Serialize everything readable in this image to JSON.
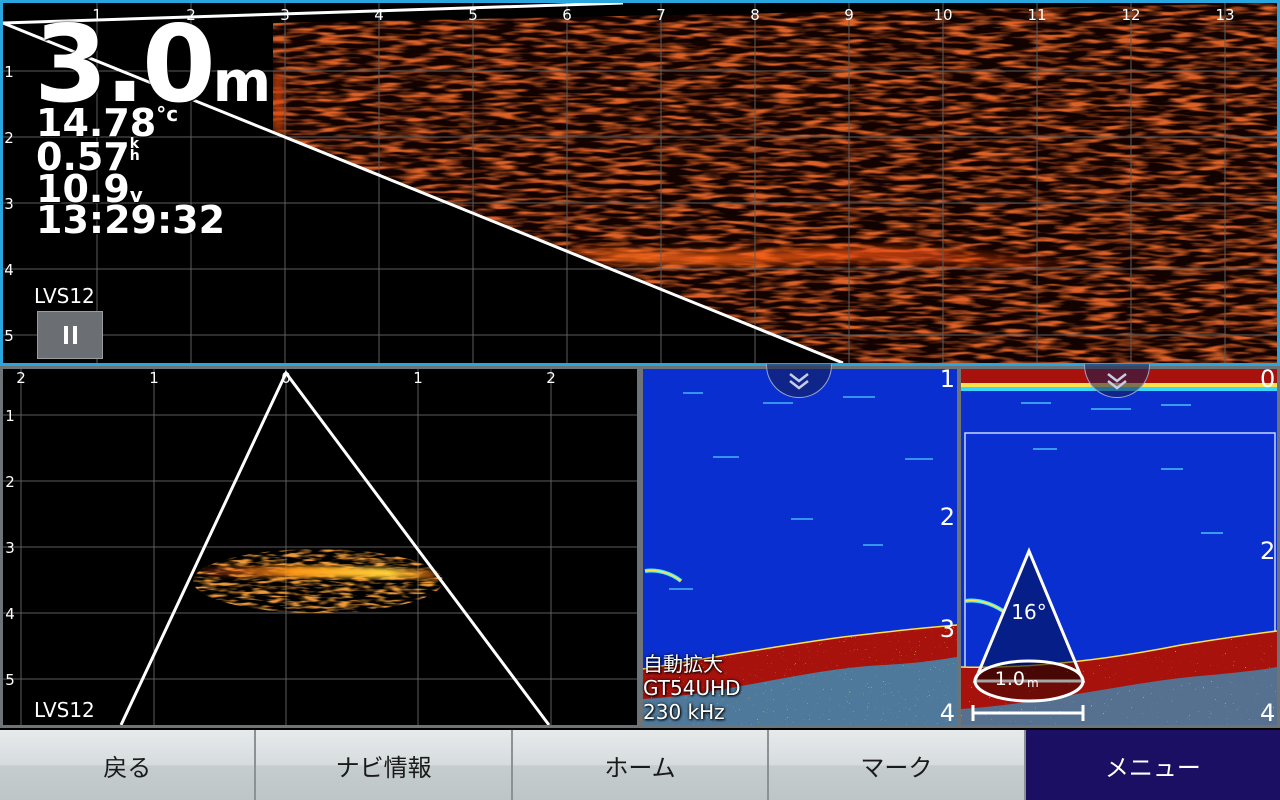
{
  "top_panel": {
    "depth_value": "3.0",
    "depth_unit": "m",
    "water_temp": "14.78",
    "water_temp_unit": "°c",
    "speed": "0.57",
    "speed_unit": "kh",
    "voltage": "10.9",
    "voltage_unit": "v",
    "time": "13:29:32",
    "transducer_label": "LVS12",
    "x_ticks": [
      "1",
      "2",
      "3",
      "4",
      "5",
      "6",
      "7",
      "8",
      "9",
      "10",
      "11",
      "12",
      "13"
    ],
    "y_ticks": [
      "1",
      "2",
      "3",
      "4",
      "5"
    ],
    "pause_icon": "pause-icon"
  },
  "front_panel": {
    "transducer_label": "LVS12",
    "x_ticks": [
      "2",
      "1",
      "0",
      "1",
      "2"
    ],
    "y_ticks": [
      "1",
      "2",
      "3",
      "4",
      "5"
    ]
  },
  "sonar1_panel": {
    "depth_ticks": [
      "1",
      "2",
      "3",
      "4"
    ],
    "mode_label": "自動拡大",
    "transducer_label": "GT54UHD",
    "frequency_label": "230 kHz",
    "collapse_icon": "double-chevron-down-icon"
  },
  "sonar2_panel": {
    "depth_ticks": [
      "0.",
      "2",
      "4"
    ],
    "cone_angle": "16°",
    "cone_diameter": "1.0",
    "cone_diameter_unit": "m",
    "collapse_icon": "double-chevron-down-icon"
  },
  "bottom_bar": {
    "back": "戻る",
    "nav_info": "ナビ情報",
    "home": "ホーム",
    "mark": "マーク",
    "menu": "メニュー"
  },
  "colors": {
    "active_pane_border": "#2aa6de",
    "pane_border": "#6e7378",
    "menu_active": "#1a0f63",
    "sonar_water": "#0a2fd0",
    "sonar_bottom": "#a8120c"
  }
}
